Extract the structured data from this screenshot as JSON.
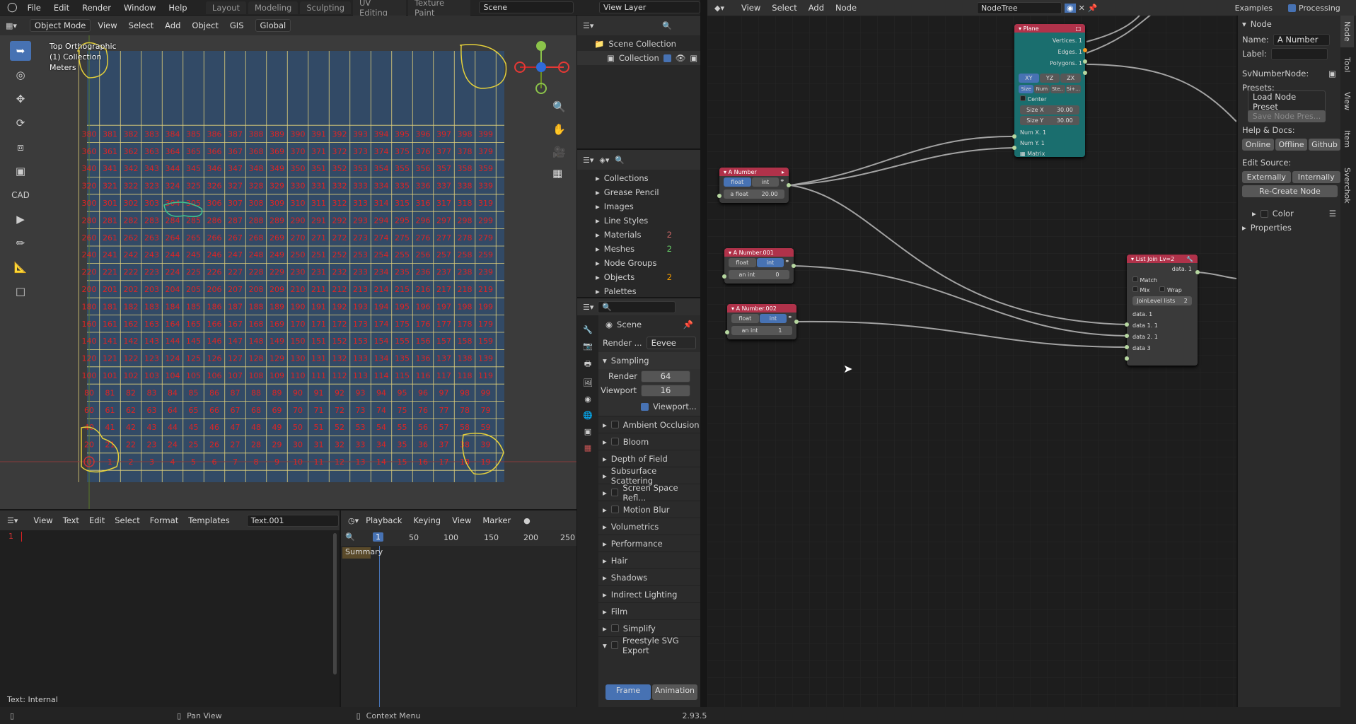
{
  "menu": {
    "items": [
      "File",
      "Edit",
      "Render",
      "Window",
      "Help"
    ]
  },
  "workspaces": [
    "Layout",
    "Modeling",
    "Sculpting",
    "UV Editing",
    "Texture Paint"
  ],
  "scene_field": "Scene",
  "view_layer_field": "View Layer",
  "viewport": {
    "mode": "Object Mode",
    "menus": [
      "View",
      "Select",
      "Add",
      "Object",
      "GIS"
    ],
    "orientation": "Global",
    "overlay_title": "Top Orthographic",
    "overlay_collection": "(1) Collection",
    "overlay_units": "Meters",
    "cad_label": "CAD"
  },
  "outliner": {
    "scene_collection": "Scene Collection",
    "collection": "Collection"
  },
  "data_browser": {
    "items": [
      "Collections",
      "Grease Pencil",
      "Images",
      "Line Styles",
      "Materials",
      "Meshes",
      "Node Groups",
      "Objects",
      "Palettes"
    ],
    "materials_count": "2",
    "meshes_count": "2",
    "objects_count": "2"
  },
  "properties": {
    "scene_label": "Scene",
    "render_engine_label": "Render ...",
    "render_engine": "Eevee",
    "sampling": "Sampling",
    "render_label": "Render",
    "render_value": "64",
    "viewport_label": "Viewport",
    "viewport_value": "16",
    "viewport_denoise": "Viewport...",
    "panels": [
      "Ambient Occlusion",
      "Bloom",
      "Depth of Field",
      "Subsurface Scattering",
      "Screen Space Refl...",
      "Motion Blur",
      "Volumetrics",
      "Performance",
      "Hair",
      "Shadows",
      "Indirect Lighting",
      "Film",
      "Simplify",
      "Freestyle SVG Export"
    ],
    "frame_tab": "Frame",
    "animation_tab": "Animation"
  },
  "text_editor": {
    "menus": [
      "View",
      "Text",
      "Edit",
      "Select",
      "Format",
      "Templates"
    ],
    "file": "Text.001",
    "line_number": "1",
    "status": "Text: Internal"
  },
  "timeline": {
    "menus": [
      "Playback",
      "Keying",
      "View",
      "Marker"
    ],
    "current_frame": "1",
    "ticks": [
      "50",
      "100",
      "150",
      "200",
      "250"
    ],
    "summary": "Summary"
  },
  "node_editor": {
    "menus": [
      "View",
      "Select",
      "Add",
      "Node"
    ],
    "tree_name": "NodeTree",
    "examples": "Examples",
    "processing": "Processing",
    "plane_node": {
      "title": "Plane",
      "outputs": [
        "Vertices. 1",
        "Edges. 1",
        "Polygons. 1"
      ],
      "modes": [
        "XY",
        "YZ",
        "ZX"
      ],
      "submodes": [
        "Size",
        "Num",
        "Ste..",
        "Si+..."
      ],
      "center": "Center",
      "size_x": "Size X",
      "size_x_val": "30.00",
      "size_y": "Size Y",
      "size_y_val": "30.00",
      "num_x": "Num X. 1",
      "num_y": "Num Y. 1",
      "matrix": "Matrix"
    },
    "number_node_1": {
      "title": "A Number",
      "float": "float",
      "int": "int",
      "field": "a float",
      "value": "20.00"
    },
    "number_node_2": {
      "title": "A Number.001",
      "float": "float",
      "int": "int",
      "field": "an int",
      "value": "0"
    },
    "number_node_3": {
      "title": "A Number.002",
      "float": "float",
      "int": "int",
      "field": "an int",
      "value": "1"
    },
    "list_join_node": {
      "title": "List Join Lv=2",
      "output": "data. 1",
      "match": "Match",
      "mix": "Mix",
      "wrap": "Wrap",
      "join_level": "JoinLevel lists",
      "join_level_val": "2",
      "inputs": [
        "data. 1",
        "data 1. 1",
        "data 2. 1",
        "data 3"
      ]
    }
  },
  "sidebar": {
    "node_header": "Node",
    "name_label": "Name:",
    "name_value": "A Number",
    "label_label": "Label:",
    "sv_node": "SvNumberNode:",
    "presets_label": "Presets:",
    "load_preset": "Load Node Preset",
    "save_preset": "Save Node Pres...",
    "help_docs": "Help & Docs:",
    "online": "Online",
    "offline": "Offline",
    "github": "Github",
    "edit_source": "Edit Source:",
    "externally": "Externally",
    "internally": "Internally",
    "recreate": "Re-Create Node",
    "color": "Color",
    "properties": "Properties",
    "tabs": [
      "Node",
      "Tool",
      "View",
      "Item",
      "Sverchok"
    ]
  },
  "status_bar": {
    "pan_view": "Pan View",
    "context_menu": "Context Menu",
    "version": "2.93.5"
  }
}
